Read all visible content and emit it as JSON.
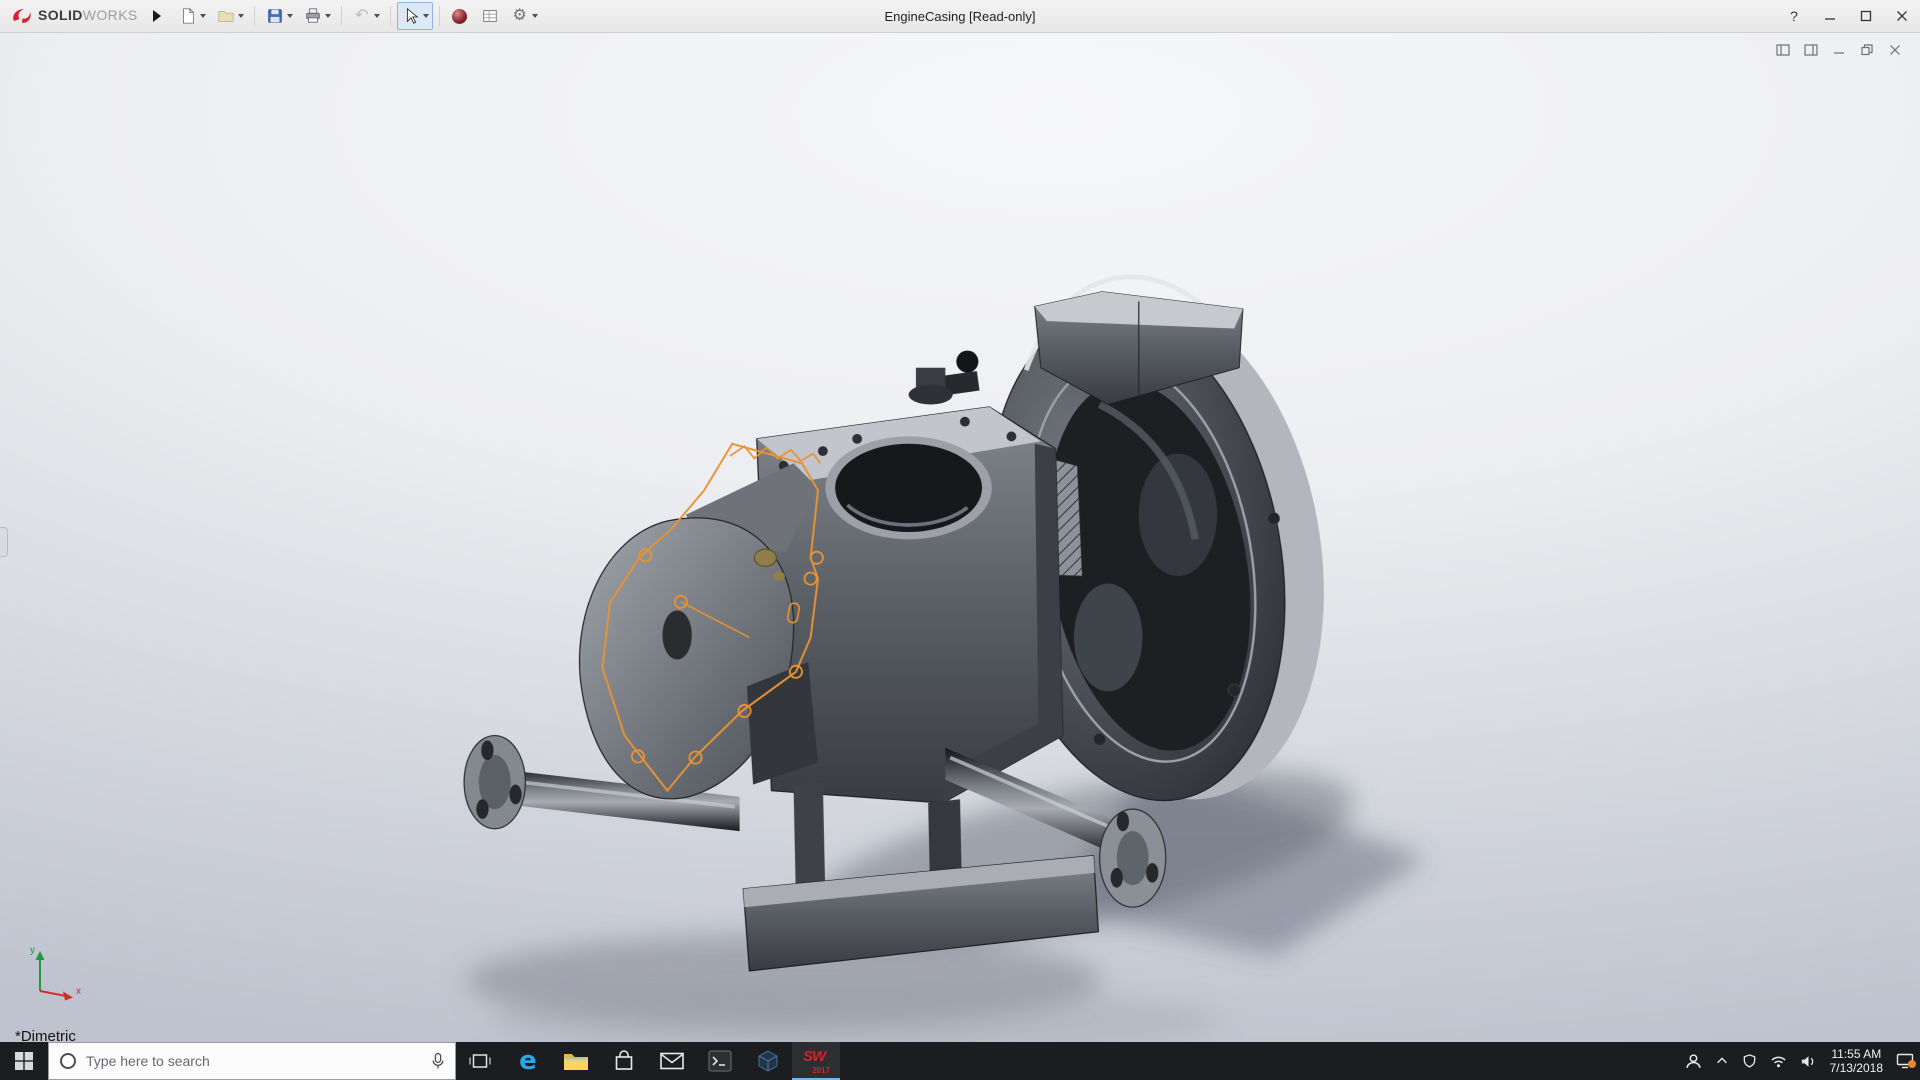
{
  "titlebar": {
    "brand": {
      "solid": "SOLID",
      "works": "WORKS"
    },
    "document_title": "EngineCasing [Read-only]",
    "help_glyph": "?"
  },
  "icons": {
    "gear": "⚙",
    "undo": "↶",
    "edge_letter": "e"
  },
  "viewport": {
    "view_orientation": "*Dimetric",
    "triad": {
      "x_label": "x",
      "y_label": "y"
    }
  },
  "taskbar": {
    "search": {
      "placeholder": "Type here to search"
    },
    "solidworks_badge": {
      "letters": "SW",
      "year": "2017"
    },
    "tray": {
      "time": "11:55 AM",
      "date": "7/13/2018"
    }
  },
  "colors": {
    "sketch_orange": "#e79333",
    "brand_red": "#d2232a",
    "taskbar_bg": "#1b1d21",
    "titlebar_bg": "#ececec",
    "model_dark": "#3a3d43"
  }
}
